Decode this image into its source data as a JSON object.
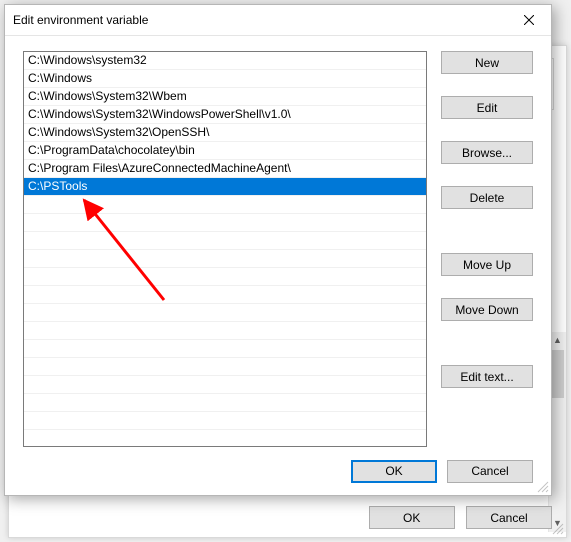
{
  "dialog": {
    "title": "Edit environment variable",
    "close_icon": "close",
    "paths": [
      "C:\\Windows\\system32",
      "C:\\Windows",
      "C:\\Windows\\System32\\Wbem",
      "C:\\Windows\\System32\\WindowsPowerShell\\v1.0\\",
      "C:\\Windows\\System32\\OpenSSH\\",
      "C:\\ProgramData\\chocolatey\\bin",
      "C:\\Program Files\\AzureConnectedMachineAgent\\",
      "C:\\PSTools"
    ],
    "selected_index": 7,
    "buttons": {
      "new": "New",
      "edit": "Edit",
      "browse": "Browse...",
      "delete": "Delete",
      "move_up": "Move Up",
      "move_down": "Move Down",
      "edit_text": "Edit text..."
    },
    "ok": "OK",
    "cancel": "Cancel"
  },
  "parent": {
    "ok": "OK",
    "cancel": "Cancel"
  },
  "annotation": {
    "arrow_color": "#ff0000"
  }
}
